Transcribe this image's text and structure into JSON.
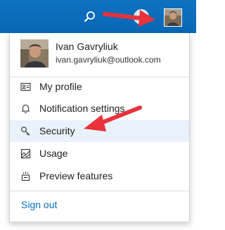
{
  "header": {
    "search_icon": "search-icon",
    "help_icon": "help-icon",
    "avatar": "user-avatar-photo"
  },
  "profile": {
    "name": "Ivan Gavryliuk",
    "email": "ivan.gavryliuk@outlook.com"
  },
  "menu": {
    "items": [
      {
        "label": "My profile",
        "icon": "id-card-icon"
      },
      {
        "label": "Notification settings",
        "icon": "bell-icon"
      },
      {
        "label": "Security",
        "icon": "key-icon",
        "selected": true
      },
      {
        "label": "Usage",
        "icon": "usage-icon"
      },
      {
        "label": "Preview features",
        "icon": "preview-features-icon"
      }
    ],
    "signout_label": "Sign out"
  },
  "colors": {
    "header_blue": "#0a6ebd",
    "accent": "#0a6ebd",
    "annotation": "#e8323c",
    "selected_bg": "#e9f1fa"
  }
}
